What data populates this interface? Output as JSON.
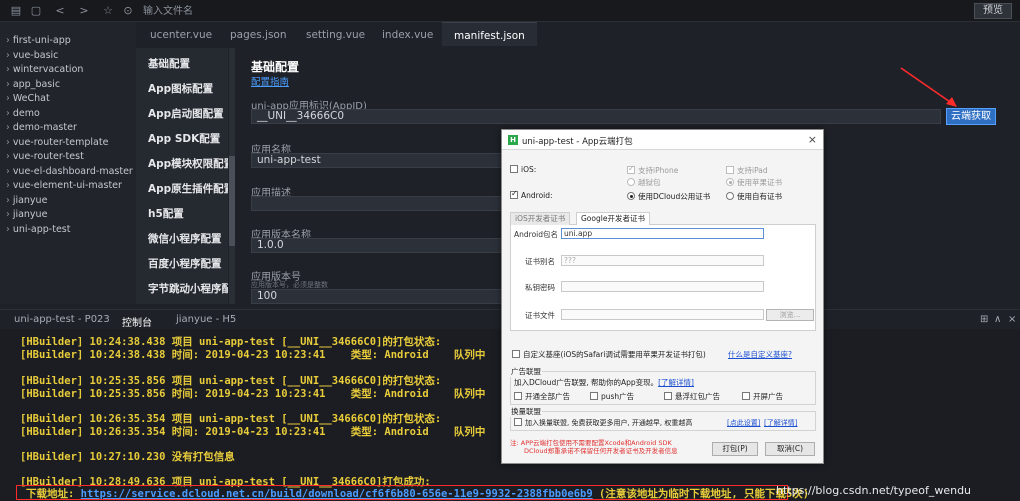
{
  "toolbar": {
    "search_placeholder": "输入文件名",
    "preview_label": "预览"
  },
  "sidebar": {
    "projects": [
      "first-uni-app",
      "vue-basic",
      "wintervacation",
      "app_basic",
      "WeChat",
      "demo",
      "demo-master",
      "vue-router-template",
      "vue-router-test",
      "vue-el-dashboard-master",
      "vue-element-ui-master",
      "jianyue",
      "jianyue",
      "uni-app-test"
    ]
  },
  "tabs": [
    "ucenter.vue",
    "pages.json",
    "setting.vue",
    "index.vue",
    "manifest.json"
  ],
  "settings_nav": [
    "基础配置",
    "App图标配置",
    "App启动图配置",
    "App SDK配置",
    "App模块权限配置",
    "App原生插件配置",
    "h5配置",
    "微信小程序配置",
    "百度小程序配置",
    "字节跳动小程序配置"
  ],
  "form": {
    "title": "基础配置",
    "guide_link": "配置指南",
    "appid_label": "uni-app应用标识(AppID)",
    "appid_value": "__UNI__34666C0",
    "cloud_button": "云端获取",
    "name_label": "应用名称",
    "name_value": "uni-app-test",
    "desc_label": "应用描述",
    "version_name_label": "应用版本名称",
    "version_name_value": "1.0.0",
    "version_code_label": "应用版本号",
    "version_code_hint": "应用版本号，必须是整数",
    "version_code_value": "100"
  },
  "console": {
    "tabs": [
      "uni-app-test - P023",
      "控制台",
      "jianyue - H5"
    ],
    "lines": [
      "[HBuilder] 10:24:38.438 项目 uni-app-test [__UNI__34666C0]的打包状态:",
      "[HBuilder] 10:24:38.438 时间: 2019-04-23 10:23:41    类型: Android    队列中",
      "[HBuilder] 10:25:35.856 项目 uni-app-test [__UNI__34666C0]的打包状态:",
      "[HBuilder] 10:25:35.856 时间: 2019-04-23 10:23:41    类型: Android    队列中",
      "[HBuilder] 10:26:35.354 项目 uni-app-test [__UNI__34666C0]的打包状态:",
      "[HBuilder] 10:26:35.354 时间: 2019-04-23 10:23:41    类型: Android    队列中",
      "[HBuilder] 10:27:10.230 没有打包信息",
      "[HBuilder] 10:28:49.636 项目 uni-app-test [__UNI__34666C0]打包成功:"
    ],
    "download_prefix": "下载地址: ",
    "download_url": "https://service.dcloud.net.cn/build/download/cf6f6b80-656e-11e9-9932-2388fbb0e6b9",
    "download_note": " (注意该地址为临时下载地址, 只能下载5次)"
  },
  "dialog": {
    "title": "uni-app-test - App云端打包",
    "ios_label": "iOS:",
    "ios_iphone": "支持iPhone",
    "ios_ipad": "支持iPad",
    "ios_jailbreak": "越狱包",
    "ios_apple_cert": "使用苹果证书",
    "android_label": "Android:",
    "android_dcloud_cert": "使用DCloud公用证书",
    "android_own_cert": "使用自有证书",
    "cert_tabs": [
      "iOS开发者证书",
      "Google开发者证书"
    ],
    "pkg_label": "Android包名",
    "pkg_value": "uni.app",
    "alias_label": "证书别名",
    "alias_placeholder": "???",
    "password_label": "私钥密码",
    "file_label": "证书文件",
    "browse_label": "浏览...",
    "custom_base_label": "自定义基座(iOS的Safari调试需要用苹果开发证书打包)",
    "custom_base_link": "什么是自定义基座?",
    "ad_group_title": "广告联盟",
    "ad_desc": "加入DCloud广告联盟, 帮助你的App变现。",
    "ad_desc_link": "[了解详情]",
    "ad_opts": [
      "开通全部广告",
      "push广告",
      "悬浮红包广告",
      "开屏广告"
    ],
    "swap_group_title": "换量联盟",
    "swap_desc": "加入换量联盟, 免费获取更多用户, 开通越早, 权重越高",
    "swap_link_setup": "[点此设置]",
    "swap_link_detail": "[了解详情]",
    "note_line1": "注: APP云端打包使用不需要配置Xcode和Android SDK",
    "note_line2": "DCloud郑重承诺不保留任何开发者证书及开发者信息",
    "pack_button": "打包(P)",
    "cancel_button": "取消(C)"
  },
  "watermark": "https://blog.csdn.net/typeof_wendu",
  "colors": {
    "accent": "#2e6fc4",
    "console_text": "#e8cc3a",
    "link": "#4a9cff",
    "highlight": "#ff2b2b"
  }
}
